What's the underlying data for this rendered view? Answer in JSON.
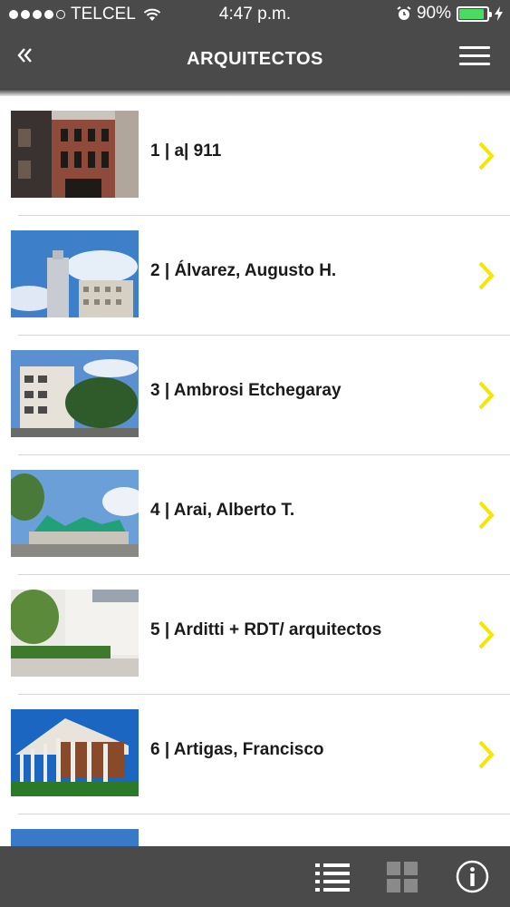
{
  "status": {
    "carrier": "TELCEL",
    "time": "4:47 p.m.",
    "battery": "90%",
    "battery_level": 0.9,
    "signal_bars": 4,
    "signal_total": 5
  },
  "nav": {
    "title": "ARQUITECTOS",
    "back_icon": "double-chevron-left-icon",
    "menu_icon": "hamburger-menu-icon"
  },
  "list": {
    "items": [
      {
        "label": "1 | a| 911"
      },
      {
        "label": "2 | Álvarez, Augusto H."
      },
      {
        "label": "3 | Ambrosi Etchegaray"
      },
      {
        "label": "4 | Arai, Alberto T."
      },
      {
        "label": "5 | Arditti + RDT/ arquitectos"
      },
      {
        "label": "6 | Artigas, Francisco"
      }
    ],
    "chevron_color": "#f5e600"
  },
  "tabbar": {
    "tabs": [
      {
        "name": "list-view-icon"
      },
      {
        "name": "grid-view-icon"
      },
      {
        "name": "info-icon"
      }
    ]
  }
}
